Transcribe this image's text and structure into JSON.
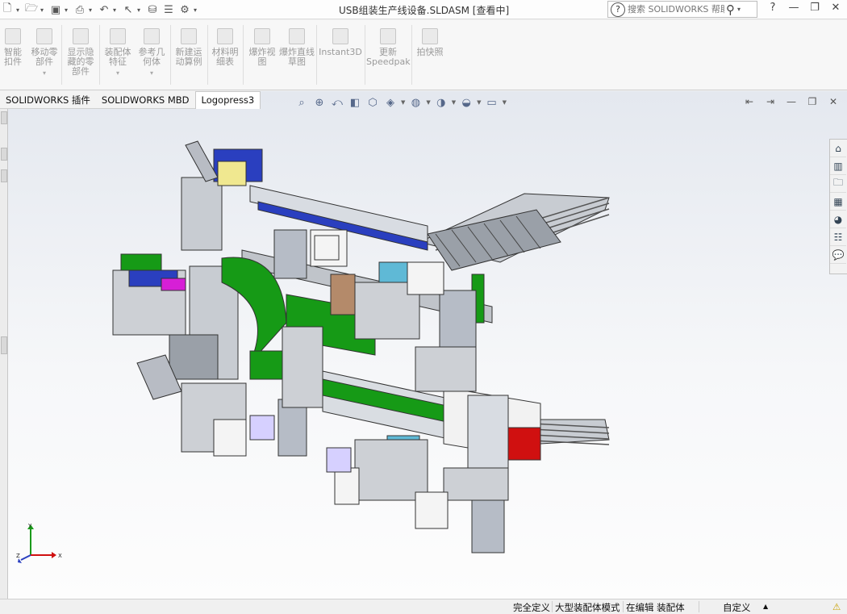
{
  "window": {
    "title": "USB组装生产线设备.SLDASM [查看中]"
  },
  "quick_access": {
    "icons": [
      "new-document-icon",
      "open-document-icon",
      "save-icon",
      "print-icon",
      "undo-icon",
      "select-icon",
      "rebuild-icon",
      "file-properties-icon",
      "options-icon"
    ]
  },
  "search": {
    "help_icon": "?",
    "placeholder": "搜索 SOLIDWORKS 帮助"
  },
  "window_controls": {
    "help": "?",
    "minimize": "—",
    "restore": "❐",
    "close": "✕"
  },
  "ribbon": {
    "buttons": [
      {
        "label": "智能扣件"
      },
      {
        "label": "移动零部件",
        "caret": "▾"
      },
      {
        "label": "显示隐藏的零部件"
      },
      {
        "label": "装配体特征",
        "caret": "▾"
      },
      {
        "label": "参考几何体",
        "caret": "▾"
      },
      {
        "label": "新建运动算例"
      },
      {
        "label": "材料明细表"
      },
      {
        "label": "爆炸视图"
      },
      {
        "label": "爆炸直线草图"
      },
      {
        "label": "Instant3D"
      },
      {
        "label": "更新Speedpak"
      },
      {
        "label": "拍快照"
      }
    ]
  },
  "tabs": [
    {
      "label": "SOLIDWORKS 插件"
    },
    {
      "label": "SOLIDWORKS MBD"
    },
    {
      "label": "Logopress3"
    }
  ],
  "heads_up_toolbar": {
    "icons": [
      "zoom-to-fit-icon",
      "zoom-to-area-icon",
      "previous-view-icon",
      "section-view-icon",
      "view-orientation-icon",
      "display-style-icon",
      "hide-show-icon",
      "edit-appearance-icon",
      "apply-scene-icon",
      "view-settings-icon"
    ]
  },
  "viewport_controls": {
    "icons": [
      "collapse-left-icon",
      "expand-right-icon",
      "viewport-minimize-icon",
      "viewport-restore-icon",
      "viewport-close-icon"
    ]
  },
  "task_pane": {
    "icons": [
      "home-icon",
      "design-library-icon",
      "file-explorer-icon",
      "view-palette-icon",
      "appearances-icon",
      "custom-properties-icon",
      "forum-icon"
    ]
  },
  "triad": {
    "x": "X",
    "y": "Y",
    "z": "Z"
  },
  "statusbar": {
    "definition": "完全定义",
    "mode": "大型装配体模式",
    "editing": "在编辑 装配体",
    "units": "自定义",
    "units_caret": "▲"
  },
  "colors": {
    "accent_green": "#169a16",
    "frame_gray": "#b8bcc4",
    "blue_part": "#2a3fbf",
    "red_part": "#d01010",
    "cyan_part": "#5fb9d6",
    "yellow_part": "#f0e890",
    "magenta_part": "#d61fd6"
  }
}
